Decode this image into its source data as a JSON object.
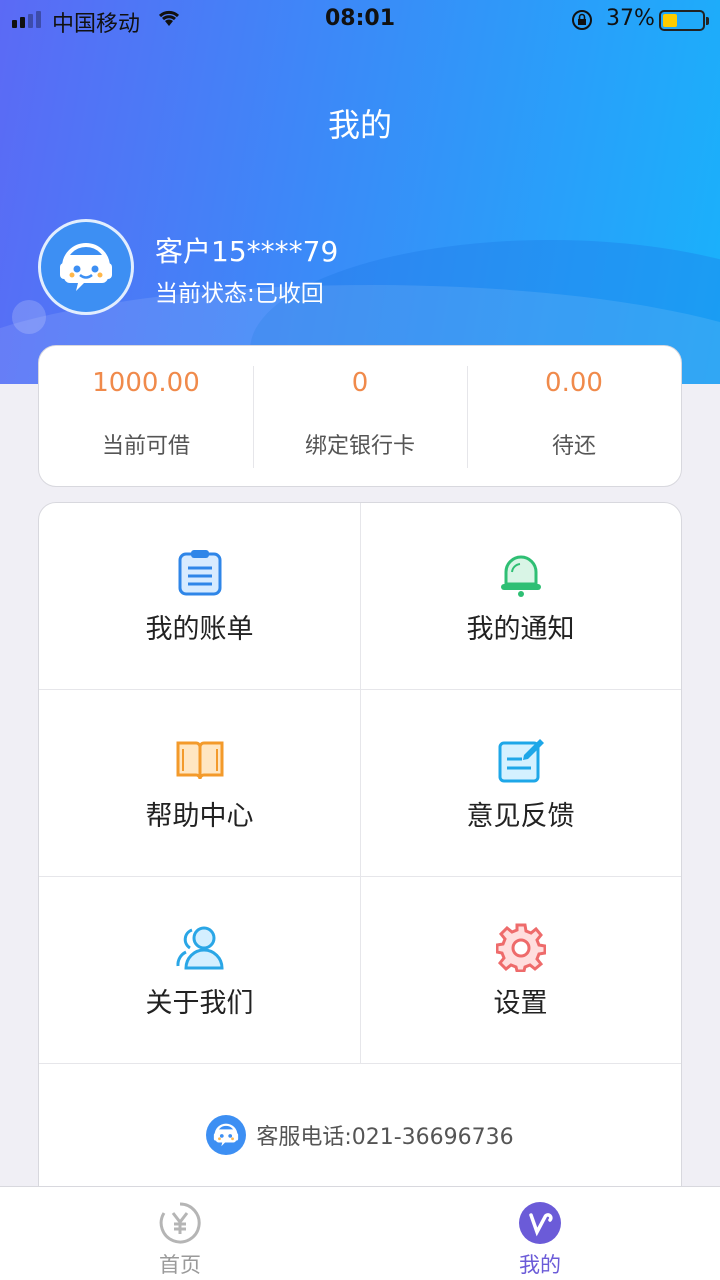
{
  "status_bar": {
    "carrier": "中国移动",
    "time": "08:01",
    "battery": "37%",
    "battery_level": 0.37
  },
  "header": {
    "title": "我的"
  },
  "user": {
    "name": "客户15****79",
    "status": "当前状态:已收回"
  },
  "stats": [
    {
      "value": "1000.00",
      "label": "当前可借"
    },
    {
      "value": "0",
      "label": "绑定银行卡"
    },
    {
      "value": "0.00",
      "label": "待还"
    }
  ],
  "menu": [
    {
      "label": "我的账单",
      "icon": "bill-icon"
    },
    {
      "label": "我的通知",
      "icon": "bell-icon"
    },
    {
      "label": "帮助中心",
      "icon": "book-icon"
    },
    {
      "label": "意见反馈",
      "icon": "feedback-icon"
    },
    {
      "label": "关于我们",
      "icon": "users-icon"
    },
    {
      "label": "设置",
      "icon": "gear-icon"
    }
  ],
  "service": {
    "text": "客服电话:021-36696736"
  },
  "tabs": [
    {
      "label": "首页",
      "icon": "yen-icon"
    },
    {
      "label": "我的",
      "icon": "profile-v-icon"
    }
  ],
  "colors": {
    "accent": "#f08a4b",
    "tab_active": "#6b5bd8",
    "header_start": "#5b6af5",
    "header_end": "#19b2fb"
  }
}
